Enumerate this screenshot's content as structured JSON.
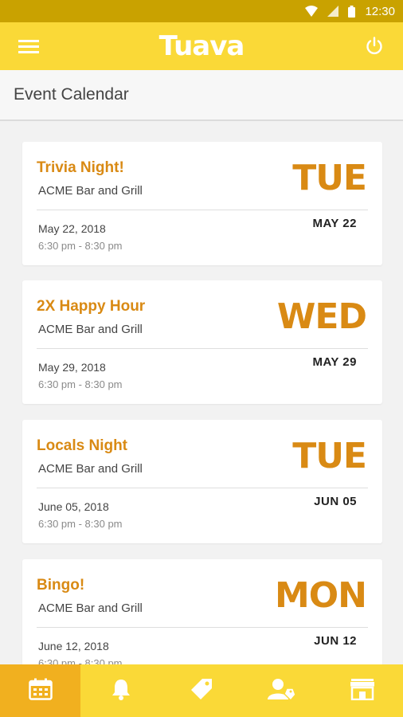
{
  "status_bar": {
    "time": "12:30",
    "icons": [
      "wifi-icon",
      "signal-icon",
      "battery-icon"
    ]
  },
  "app_bar": {
    "brand": "Tuava",
    "left_icon": "hamburger-menu-icon",
    "right_icon": "power-icon"
  },
  "page": {
    "title": "Event Calendar"
  },
  "events": [
    {
      "name": "Trivia Night!",
      "venue": "ACME Bar and Grill",
      "date": "May 22, 2018",
      "time": "6:30 pm - 8:30 pm",
      "dow": "TUE",
      "month_day": "MAY  22"
    },
    {
      "name": "2X Happy Hour",
      "venue": "ACME Bar and Grill",
      "date": "May 29, 2018",
      "time": "6:30 pm - 8:30 pm",
      "dow": "WED",
      "month_day": "MAY  29"
    },
    {
      "name": "Locals Night",
      "venue": "ACME Bar and Grill",
      "date": "June 05, 2018",
      "time": "6:30 pm - 8:30 pm",
      "dow": "TUE",
      "month_day": "JUN  05"
    },
    {
      "name": "Bingo!",
      "venue": "ACME Bar and Grill",
      "date": "June 12, 2018",
      "time": "6:30 pm - 8:30 pm",
      "dow": "MON",
      "month_day": "JUN  12"
    }
  ],
  "bottom_nav": {
    "items": [
      "calendar-icon",
      "bell-icon",
      "tag-icon",
      "user-tag-icon",
      "store-icon"
    ],
    "active": "calendar-icon"
  },
  "colors": {
    "accent": "#d98a14",
    "app_bar": "#fad937",
    "status_bar": "#c9a200",
    "nav_active": "#f1b01f"
  }
}
